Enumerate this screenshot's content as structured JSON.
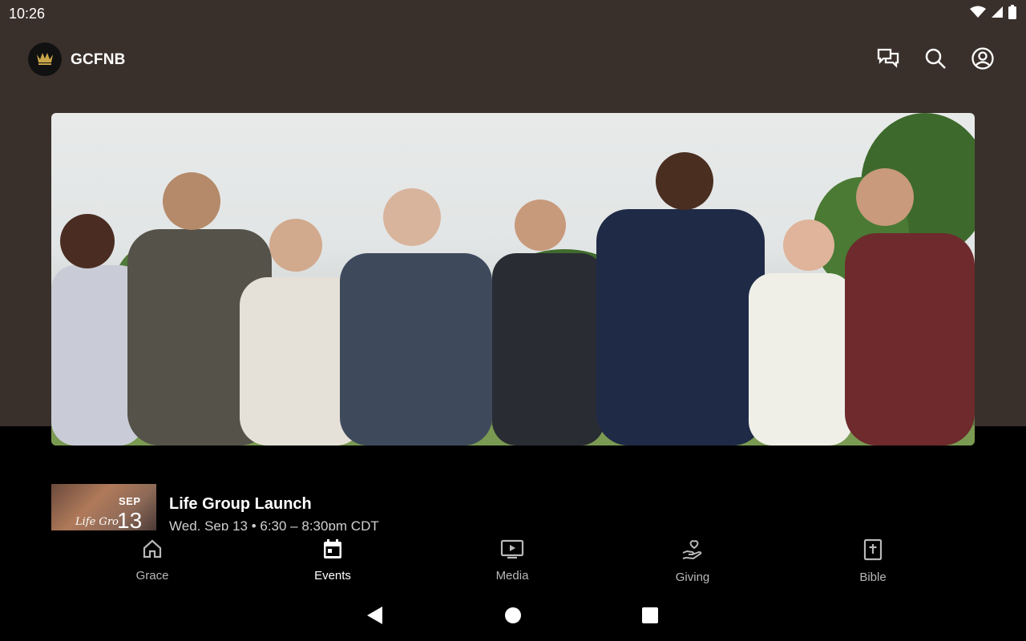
{
  "status_bar": {
    "time": "10:26"
  },
  "header": {
    "brand": "GCFNB"
  },
  "header_actions": [
    "chat-icon",
    "search-icon",
    "account-icon"
  ],
  "event": {
    "title": "Life Group Launch",
    "subtitle": "Wed, Sep 13 • 6:30 – 8:30pm CDT",
    "thumb_month": "SEP",
    "thumb_day": "13",
    "thumb_script": "Life Gro"
  },
  "nav": {
    "items": [
      {
        "label": "Grace",
        "icon": "home-icon",
        "active": false
      },
      {
        "label": "Events",
        "icon": "calendar-icon",
        "active": true
      },
      {
        "label": "Media",
        "icon": "media-play-icon",
        "active": false
      },
      {
        "label": "Giving",
        "icon": "giving-hand-icon",
        "active": false
      },
      {
        "label": "Bible",
        "icon": "bible-icon",
        "active": false
      }
    ]
  },
  "colors": {
    "header_bg": "#3a302b",
    "background": "#000000",
    "text": "#ffffff",
    "nav_inactive": "#b8b8b8"
  }
}
